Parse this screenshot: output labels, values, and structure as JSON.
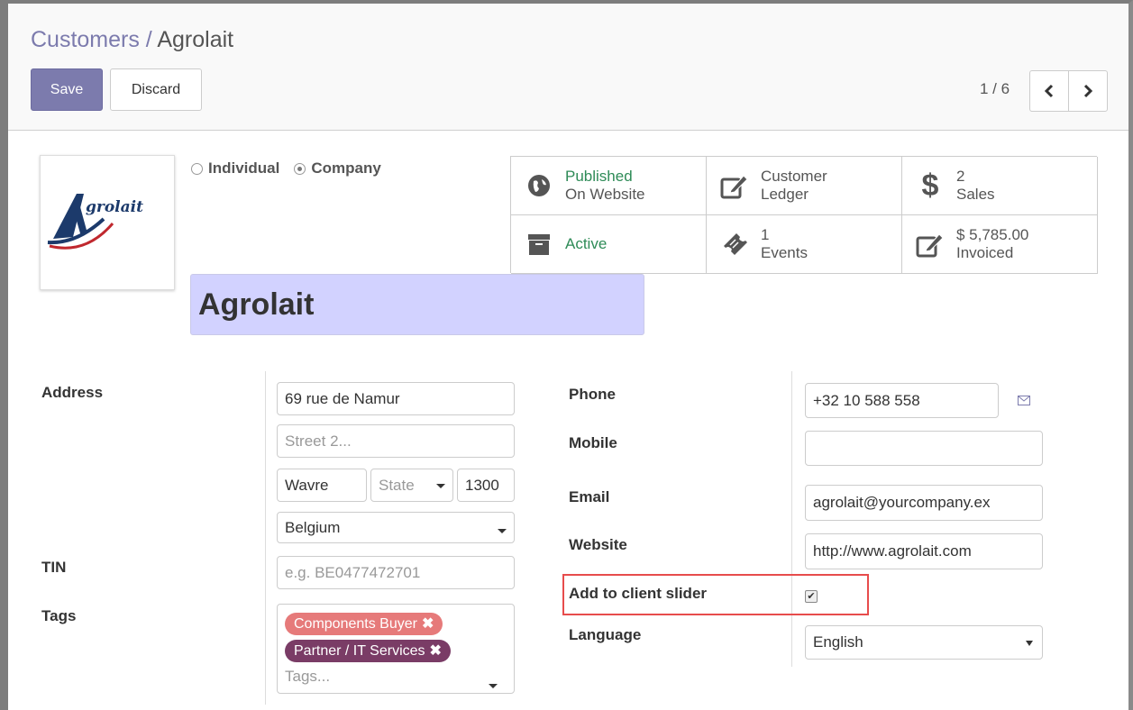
{
  "breadcrumb": {
    "parent": "Customers /",
    "current": "Agrolait"
  },
  "toolbar": {
    "save_label": "Save",
    "discard_label": "Discard"
  },
  "pager": {
    "value": "1 / 6"
  },
  "logo": {
    "text": "grolait"
  },
  "company_type": {
    "individual": "Individual",
    "company": "Company",
    "selected": "Company"
  },
  "smart_buttons": {
    "published": {
      "line1": "Published",
      "line2": "On Website"
    },
    "ledger": {
      "line1": "Customer",
      "line2": "Ledger"
    },
    "sales": {
      "count": "2",
      "label": "Sales"
    },
    "active": {
      "label": "Active"
    },
    "events": {
      "count": "1",
      "label": "Events"
    },
    "invoiced": {
      "amount": "$ 5,785.00",
      "label": "Invoiced"
    }
  },
  "name": "Agrolait",
  "fields": {
    "address_label": "Address",
    "street": "69 rue de Namur",
    "street2_placeholder": "Street 2...",
    "city": "Wavre",
    "state_placeholder": "State",
    "zip": "1300",
    "country": "Belgium",
    "tin_label": "TIN",
    "tin_placeholder": "e.g. BE0477472701",
    "tags_label": "Tags",
    "tags": [
      "Components Buyer",
      "Partner / IT Services"
    ],
    "tags_placeholder": "Tags...",
    "phone_label": "Phone",
    "phone": "+32 10 588 558",
    "mobile_label": "Mobile",
    "mobile": "",
    "email_label": "Email",
    "email": "agrolait@yourcompany.ex",
    "website_label": "Website",
    "website": "http://www.agrolait.com",
    "slider_label": "Add to client slider",
    "slider_checked": true,
    "language_label": "Language",
    "language": "English"
  },
  "colors": {
    "brand": "#7c7bad",
    "highlight": "#e74c4c",
    "tag1": "#e67a7a",
    "tag2": "#7a3c66"
  }
}
